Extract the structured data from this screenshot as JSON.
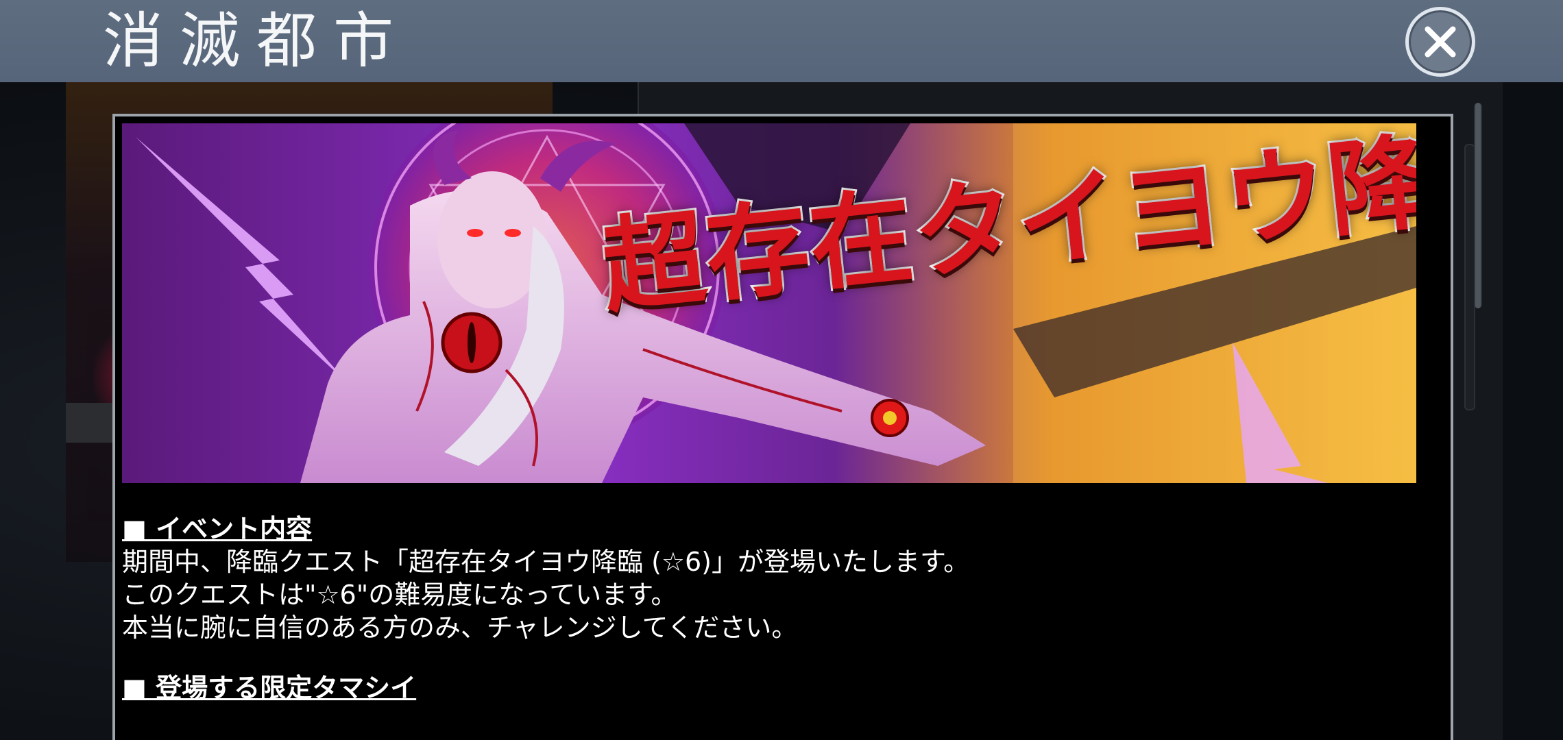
{
  "header": {
    "title": "消滅都市",
    "close_icon": "close-icon"
  },
  "banner": {
    "title_text": "超存在タイヨウ降臨"
  },
  "content": {
    "section1_heading": "■ イベント内容",
    "section1_lines": [
      "期間中、降臨クエスト「超存在タイヨウ降臨 (☆6)」が登場いたします。",
      "このクエストは\"☆6\"の難易度になっています。",
      "本当に腕に自信のある方のみ、チャレンジしてください。"
    ],
    "section2_heading": "■ 登場する限定タマシイ"
  },
  "colors": {
    "titlebar": "#5f6d80",
    "dialog_border": "#9ea4ab",
    "banner_purple": "#7a2bb8",
    "banner_gold": "#f2b233",
    "banner_title_red": "#c5121b"
  }
}
